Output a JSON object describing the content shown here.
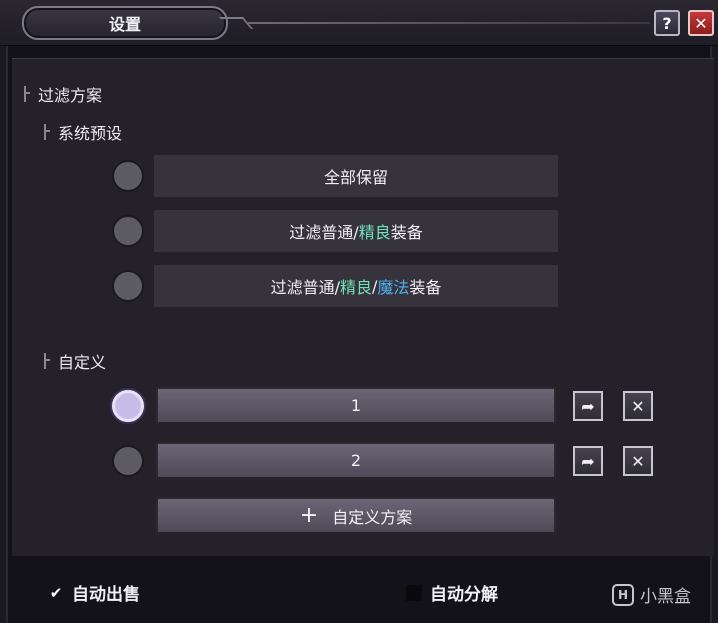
{
  "window": {
    "title": "设置",
    "help_label": "?",
    "close_label": "✕"
  },
  "filter": {
    "heading": "过滤方案",
    "system_preset_heading": "系统预设",
    "presets": [
      {
        "label": "全部保留"
      },
      {
        "parts": [
          "过滤普通/",
          "精良",
          "装备"
        ]
      },
      {
        "parts": [
          "过滤普通/",
          "精良",
          "/",
          "魔法",
          "装备"
        ]
      }
    ],
    "custom_heading": "自定义",
    "custom_items": [
      {
        "label": "1",
        "selected": true
      },
      {
        "label": "2",
        "selected": false
      }
    ],
    "add_custom_label": "自定义方案"
  },
  "footer": {
    "auto_sell_label": "自动出售",
    "auto_sell_checked": true,
    "auto_disassemble_label": "自动分解",
    "auto_disassemble_checked": false,
    "watermark": "小黑盒"
  },
  "colors": {
    "fine_quality": "#6fe3b6",
    "magic_quality": "#4fb2f0",
    "selected_radio": "#c9bde8"
  }
}
